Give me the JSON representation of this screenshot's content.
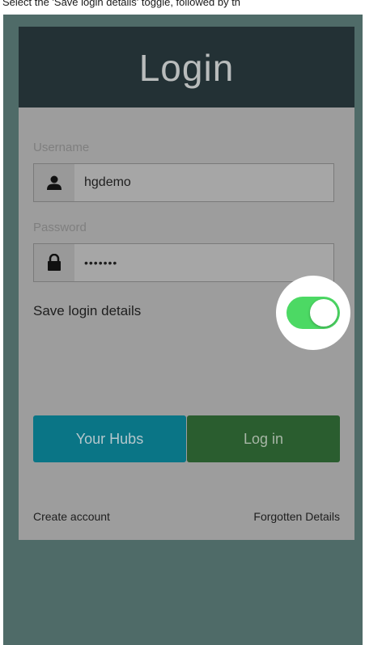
{
  "instruction": "Select the 'Save login details' toggle, followed by th",
  "header": {
    "title": "Login"
  },
  "form": {
    "username_label": "Username",
    "username_value": "hgdemo",
    "password_label": "Password",
    "password_value": "•••••••",
    "save_label": "Save login details",
    "save_toggle_on": true
  },
  "buttons": {
    "hubs_label": "Your Hubs",
    "login_label": "Log in"
  },
  "links": {
    "create_account": "Create account",
    "forgotten_details": "Forgotten Details"
  },
  "icons": {
    "user": "user-icon",
    "lock": "lock-icon"
  },
  "colors": {
    "header_bg": "#233135",
    "toggle_on": "#4cd964",
    "hubs_button": "#0a7586",
    "login_button": "#2a5d2f",
    "screen_bg": "#4f6b68"
  }
}
